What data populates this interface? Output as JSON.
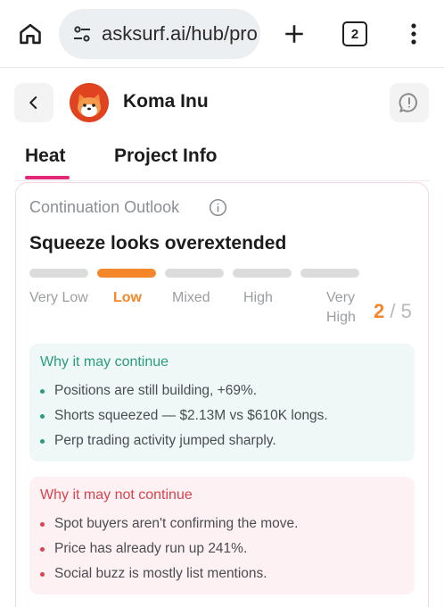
{
  "browser": {
    "url": "asksurf.ai/hub/pro",
    "tab_count": "2",
    "icons": [
      "home-icon",
      "tune-icon",
      "plus-icon",
      "tabs-icon",
      "more-vert-icon"
    ]
  },
  "header": {
    "project_name": "Koma Inu",
    "icons": [
      "back-arrow-icon",
      "avatar",
      "chat-alert-icon"
    ]
  },
  "tabs": [
    {
      "label": "Heat",
      "active": true
    },
    {
      "label": "Project Info",
      "active": false
    }
  ],
  "outlook": {
    "label": "Continuation Outlook",
    "headline": "Squeeze looks overextended",
    "levels": [
      {
        "label": "Very Low",
        "active": false
      },
      {
        "label": "Low",
        "active": true
      },
      {
        "label": "Mixed",
        "active": false
      },
      {
        "label": "High",
        "active": false
      },
      {
        "label": "Very",
        "label2": "High",
        "active": false
      }
    ],
    "score": "2",
    "score_max": "/ 5"
  },
  "continue_panel": {
    "title": "Why it may continue",
    "items": [
      "Positions are still building, +69%.",
      "Shorts squeezed — $2.13M vs $610K longs.",
      "Perp trading activity jumped sharply."
    ]
  },
  "not_continue_panel": {
    "title": "Why it may not continue",
    "items": [
      "Spot buyers aren't confirming the move.",
      "Price has already run up 241%.",
      "Social buzz is mostly list mentions."
    ]
  },
  "colors": {
    "accent_orange": "#f5862a",
    "tab_underline": "#e3287a",
    "green": "#2a9d7c",
    "red": "#d9434e"
  }
}
